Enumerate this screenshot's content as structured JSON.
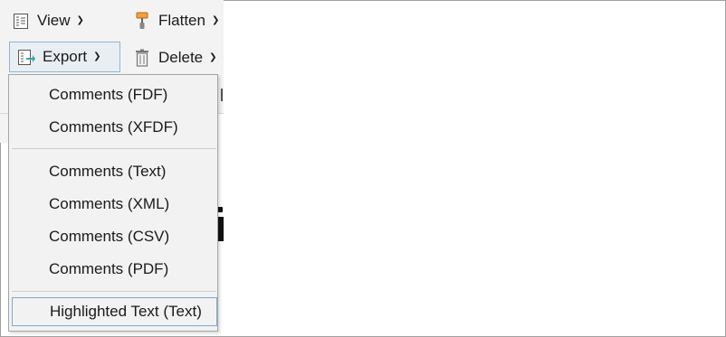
{
  "toolbar": {
    "view_label": "View",
    "flatten_label": "Flatten",
    "export_label": "Export",
    "delete_label": "Delete"
  },
  "export_menu": {
    "group1": [
      "Comments (FDF)",
      "Comments (XFDF)"
    ],
    "group2": [
      "Comments (Text)",
      "Comments (XML)",
      "Comments (CSV)",
      "Comments (PDF)"
    ],
    "group3": [
      "Highlighted Text (Text)"
    ]
  },
  "colors": {
    "accent_border": "#7fa9cf",
    "menu_bg": "#f2f2f2",
    "toolbar_bg": "#f3f3f3"
  },
  "icons": {
    "view": "view-document-icon",
    "flatten": "paint-roller-icon",
    "export": "export-document-icon",
    "delete": "trash-icon"
  }
}
